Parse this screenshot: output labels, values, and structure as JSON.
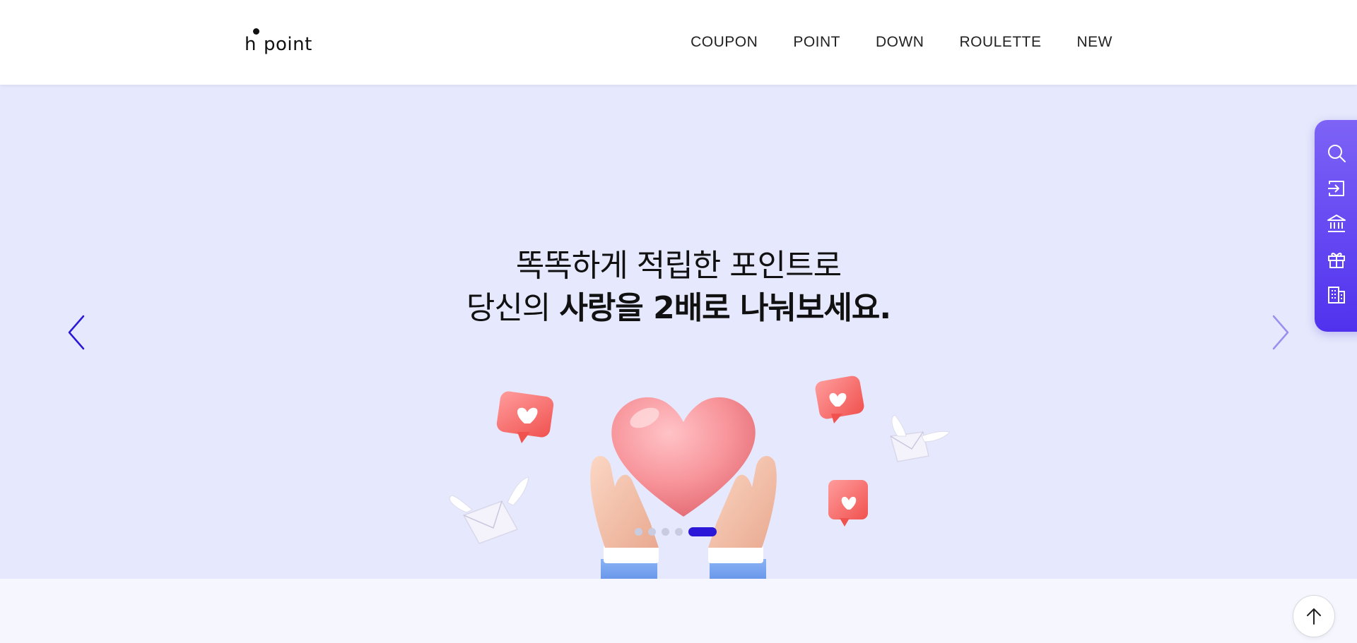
{
  "header": {
    "logo_letter": "h",
    "logo_text": "point",
    "nav": [
      "COUPON",
      "POINT",
      "DOWN",
      "ROULETTE",
      "NEW"
    ]
  },
  "hero": {
    "line1": "똑똑하게 적립한 포인트로",
    "line2_regular": "당신의 ",
    "line2_bold": "사랑을 2배로 나눠보세요.",
    "slide_count": 5,
    "active_slide": 5,
    "background_color": "#e6e9fd",
    "accent_color": "#2a17d8"
  },
  "quick_menu": {
    "items": [
      "search-icon",
      "login-icon",
      "bank-icon",
      "gift-icon",
      "building-icon"
    ],
    "gradient": [
      "#7e63f6",
      "#5032ee"
    ]
  },
  "scroll_top": {
    "icon": "arrow-up-icon"
  }
}
